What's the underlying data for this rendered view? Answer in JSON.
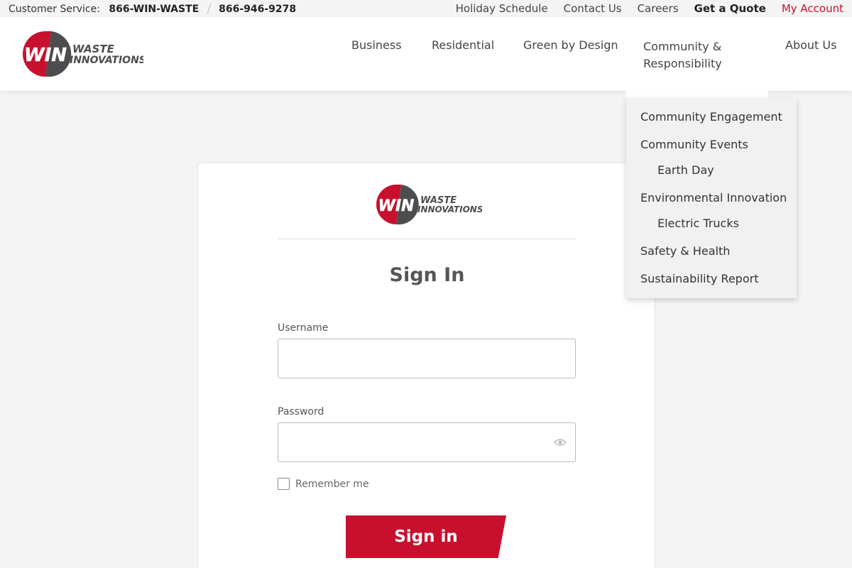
{
  "utility": {
    "cs_label": "Customer Service:",
    "phone_1": "866-WIN-WASTE",
    "phone_2": "866-946-9278",
    "links": [
      "Holiday Schedule",
      "Contact Us",
      "Careers"
    ],
    "quote": "Get a Quote",
    "account": "My Account"
  },
  "brand": {
    "logo_mark": "WIN",
    "logo_line1": "WASTE",
    "logo_line2": "INNOVATIONS",
    "red": "#c8102e",
    "gray": "#4d4d4f"
  },
  "nav": {
    "business": "Business",
    "residential": "Residential",
    "green": "Green by Design",
    "community": "Community & Responsibility",
    "about": "About Us"
  },
  "dropdown": {
    "items": [
      "Community Engagement",
      "Community Events",
      "Earth Day",
      "Environmental Innovation",
      "Electric Trucks",
      "Safety & Health",
      "Sustainability Report"
    ]
  },
  "form": {
    "title": "Sign In",
    "username_label": "Username",
    "username_value": "",
    "password_label": "Password",
    "password_value": "",
    "remember_label": "Remember me",
    "submit_label": "Sign in"
  }
}
